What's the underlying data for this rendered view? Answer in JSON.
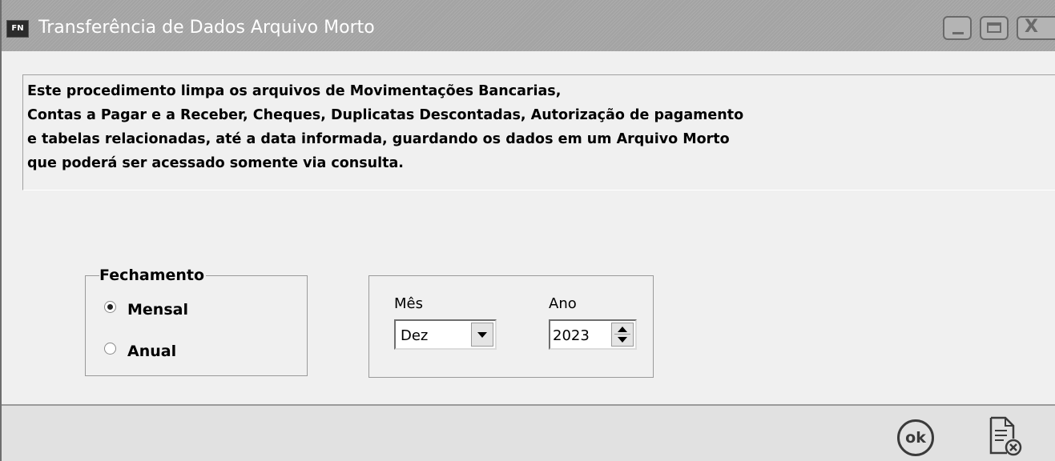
{
  "window": {
    "icon_text": "FN",
    "title": "Transferência de Dados Arquivo Morto",
    "controls": {
      "minimize": "_",
      "close": "X"
    }
  },
  "info": {
    "lines": [
      "Este procedimento limpa os arquivos de Movimentações Bancarias,",
      "Contas a Pagar e a Receber, Cheques, Duplicatas Descontadas, Autorização de pagamento",
      "e tabelas relacionadas, até a data informada, guardando os dados em um Arquivo Morto",
      "que poderá ser acessado somente via consulta."
    ]
  },
  "fechamento": {
    "label": "Fechamento",
    "options": [
      {
        "label": "Mensal",
        "selected": true
      },
      {
        "label": "Anual",
        "selected": false
      }
    ]
  },
  "periodo": {
    "mes_label": "Mês",
    "mes_value": "Dez",
    "ano_label": "Ano",
    "ano_value": "2023"
  },
  "footer": {
    "ok_label": "ok"
  },
  "icons": {
    "ok": "ok-icon",
    "cancel": "cancel-document-icon",
    "dropdown": "chevron-down-icon",
    "spinner": "spinner-arrows-icon"
  }
}
